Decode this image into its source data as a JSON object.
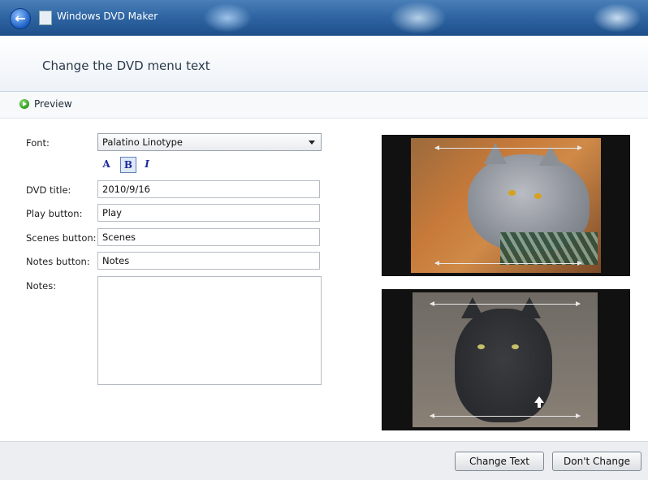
{
  "window": {
    "app_title": "Windows DVD Maker",
    "back_icon": "back-arrow-icon"
  },
  "page": {
    "title": "Change the DVD menu text"
  },
  "toolbar": {
    "preview_label": "Preview",
    "preview_icon": "play-icon"
  },
  "form": {
    "font_label": "Font:",
    "font_value": "Palatino Linotype",
    "format_buttons": [
      "A",
      "B",
      "I"
    ],
    "dvd_title_label": "DVD title:",
    "dvd_title_value": "2010/9/16",
    "play_label": "Play button:",
    "play_value": "Play",
    "scenes_label": "Scenes button:",
    "scenes_value": "Scenes",
    "notes_button_label": "Notes button:",
    "notes_button_value": "Notes",
    "notes_label": "Notes:",
    "notes_value": ""
  },
  "buttons": {
    "change_text": "Change Text",
    "dont_change": "Don't Change"
  },
  "colors": {
    "titlebar": "#2f66a3",
    "accent": "#1a2a9a",
    "footer": "#eceef1"
  }
}
